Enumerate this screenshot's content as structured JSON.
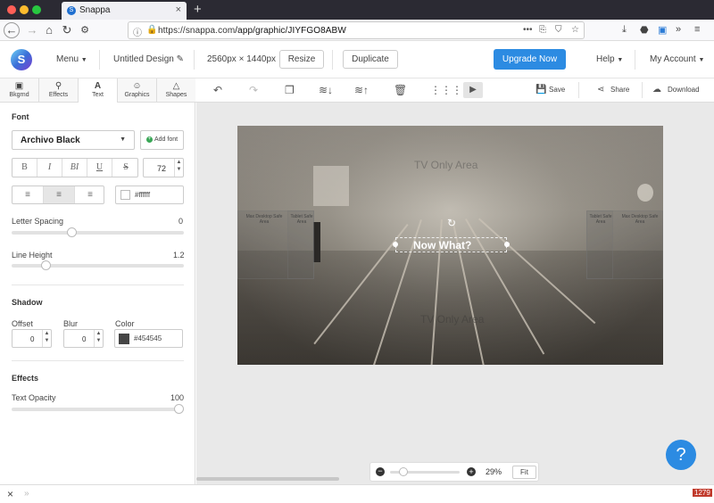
{
  "browser": {
    "tab_title": "Snappa",
    "url_host": "https://snappa.com",
    "url_path": "/app/graphic/JIYFGO8ABW",
    "status_badge": "1279"
  },
  "header": {
    "menu_label": "Menu",
    "design_title": "Untitled Design",
    "dimensions": "2560px × 1440px",
    "resize_label": "Resize",
    "duplicate_label": "Duplicate",
    "upgrade_label": "Upgrade Now",
    "help_label": "Help",
    "account_label": "My Account"
  },
  "left_tabs": [
    {
      "label": "Bkgrnd",
      "icon": "image-icon"
    },
    {
      "label": "Effects",
      "icon": "magic-wand-icon"
    },
    {
      "label": "Text",
      "icon": "text-icon"
    },
    {
      "label": "Graphics",
      "icon": "smiley-icon"
    },
    {
      "label": "Shapes",
      "icon": "triangle-icon"
    }
  ],
  "font_panel": {
    "section_font": "Font",
    "font_family": "Archivo Black",
    "add_font": "Add font",
    "format_buttons": [
      "B",
      "I",
      "BI",
      "U",
      "S"
    ],
    "font_size": "72",
    "text_color": "#ffffff",
    "letter_spacing_label": "Letter Spacing",
    "letter_spacing_value": "0",
    "letter_spacing_fraction": 0.34,
    "line_height_label": "Line Height",
    "line_height_value": "1.2",
    "line_height_fraction": 0.18,
    "section_shadow": "Shadow",
    "offset_label": "Offset",
    "offset_value": "0",
    "blur_label": "Blur",
    "blur_value": "0",
    "shadow_color_label": "Color",
    "shadow_color": "#454545",
    "section_effects": "Effects",
    "opacity_label": "Text Opacity",
    "opacity_value": "100",
    "opacity_fraction": 1.0
  },
  "toolbar": {
    "save_label": "Save",
    "share_label": "Share",
    "download_label": "Download"
  },
  "canvas": {
    "tv_zone": "TV Only Area",
    "desktop_zone_left": "Max Desktop Safe Area",
    "tablet_zone_left": "Tablet Safe Area",
    "tablet_zone_right": "Tablet Safe Area",
    "desktop_zone_right": "Max Desktop Safe Area",
    "phone_zone": "TV Only Area",
    "text_layer": "Now What?"
  },
  "zoom": {
    "value": "29%",
    "fit_label": "Fit",
    "fraction": 0.15
  },
  "colors": {
    "accent": "#2c8be2",
    "shadow_swatch": "#454545"
  }
}
